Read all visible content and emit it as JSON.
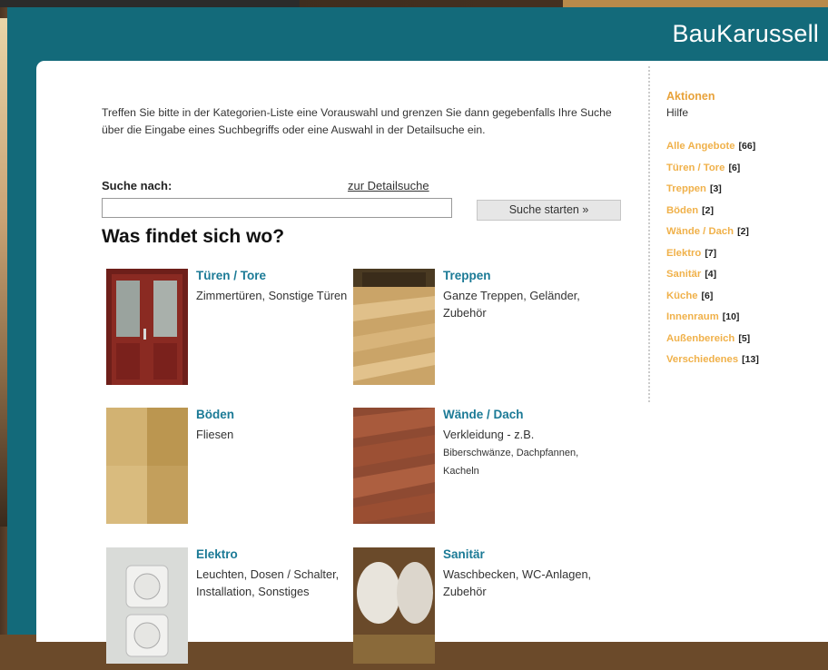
{
  "site": {
    "brand": "BauKarussell"
  },
  "intro": "Treffen Sie bitte in der Kategorien-Liste eine Vorauswahl und grenzen Sie dann gegebenfalls Ihre Suche über die Eingabe eines Suchbegriffs oder eine Auswahl in der Detailsuche ein.",
  "search": {
    "label": "Suche nach:",
    "detail_link": "zur Detailsuche",
    "value": "",
    "button": "Suche starten »"
  },
  "section_title": "Was findet sich wo?",
  "categories": [
    {
      "title": "Türen / Tore",
      "desc": "Zimmertüren, Sonstige Türen",
      "desc_small": ""
    },
    {
      "title": "Treppen",
      "desc": "Ganze Treppen, Geländer, Zubehör",
      "desc_small": ""
    },
    {
      "title": "Böden",
      "desc": "Fliesen",
      "desc_small": ""
    },
    {
      "title": "Wände / Dach",
      "desc": "Verkleidung - z.B.",
      "desc_small": "Biberschwänze, Dachpfannen, Kacheln"
    },
    {
      "title": "Elektro",
      "desc": "Leuchten, Dosen / Schalter, Installation, Sonstiges",
      "desc_small": ""
    },
    {
      "title": "Sanitär",
      "desc": "Waschbecken, WC-Anlagen, Zubehör",
      "desc_small": ""
    }
  ],
  "sidebar": {
    "heading": "Aktionen",
    "help": "Hilfe",
    "items": [
      {
        "label": "Alle Angebote",
        "count": "[66]"
      },
      {
        "label": "Türen / Tore",
        "count": "[6]"
      },
      {
        "label": "Treppen",
        "count": "[3]"
      },
      {
        "label": "Böden",
        "count": "[2]"
      },
      {
        "label": "Wände / Dach",
        "count": "[2]"
      },
      {
        "label": "Elektro",
        "count": "[7]"
      },
      {
        "label": "Sanitär",
        "count": "[4]"
      },
      {
        "label": "Küche",
        "count": "[6]"
      },
      {
        "label": "Innenraum",
        "count": "[10]"
      },
      {
        "label": "Außenbereich",
        "count": "[5]"
      },
      {
        "label": "Verschiedenes",
        "count": "[13]"
      }
    ]
  },
  "colors": {
    "header": "#136a7a",
    "link": "#1b7a96",
    "accent": "#e8a23a"
  }
}
